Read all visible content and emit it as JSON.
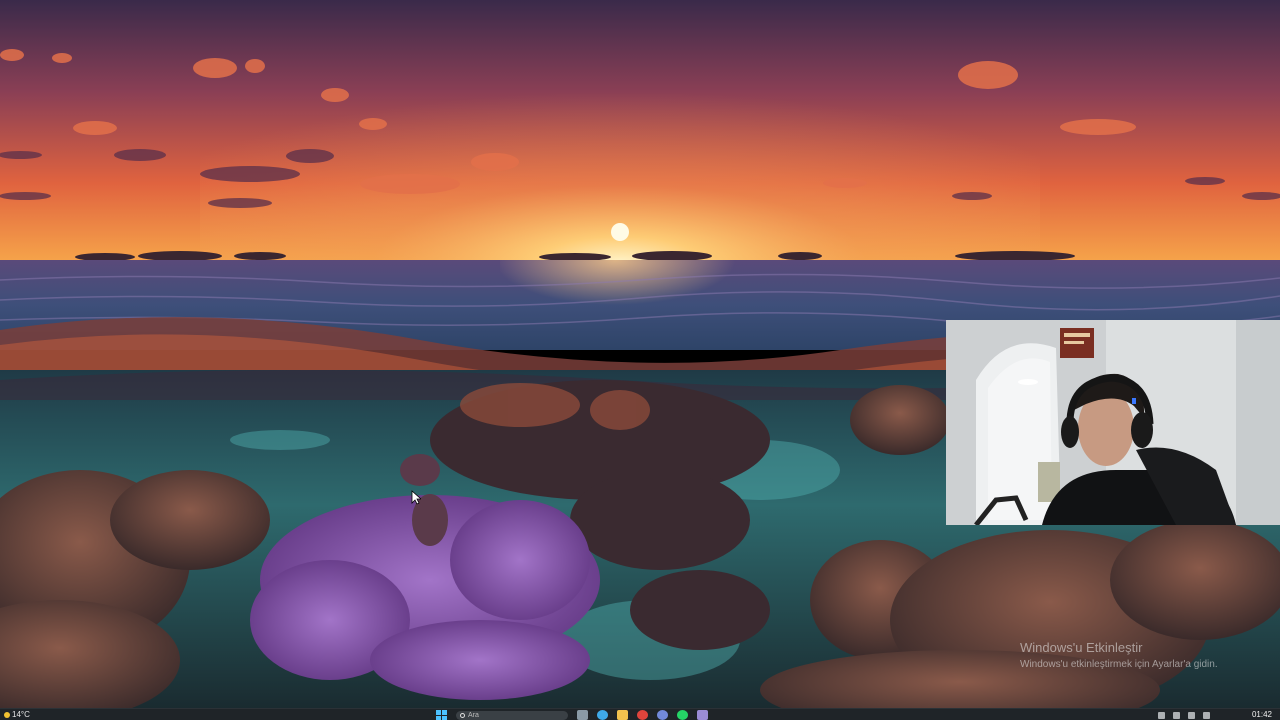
{
  "watermark": {
    "title": "Windows'u Etkinleştir",
    "subtitle": "Windows'u etkinleştirmek için Ayarlar'a gidin."
  },
  "taskbar": {
    "weather": {
      "temperature": "14°C",
      "icon": "sun-icon"
    },
    "search": {
      "placeholder": "Ara",
      "icon": "search-icon"
    },
    "pinned_apps": [
      {
        "name": "file-manager-icon",
        "color": "#8a9aa6"
      },
      {
        "name": "edge-icon",
        "color": "#3fa9e8"
      },
      {
        "name": "folder-icon",
        "color": "#f2c14e"
      },
      {
        "name": "chrome-icon",
        "color": "#e0443c"
      },
      {
        "name": "discord-icon",
        "color": "#7289da"
      },
      {
        "name": "whatsapp-icon",
        "color": "#25d366"
      },
      {
        "name": "app-icon",
        "color": "#9b8cd6"
      }
    ],
    "clock": "01:42"
  },
  "colors": {
    "accent": "#4cc2ff",
    "taskbar_bg": "#1f2428"
  }
}
